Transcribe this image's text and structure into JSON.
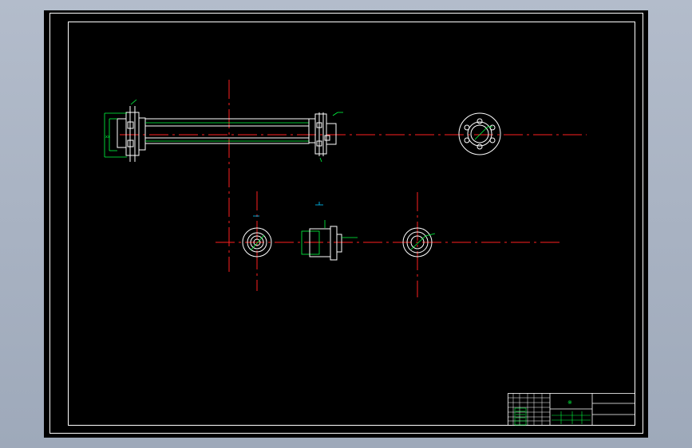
{
  "drawing": {
    "background": "#000000",
    "title_block": {
      "mark": "※"
    }
  },
  "colors": {
    "part_outline": "#ffffff",
    "centerline": "#ff2020",
    "dimension": "#00ff40",
    "frame": "#ffffff",
    "annotation": "#00c8ff"
  }
}
